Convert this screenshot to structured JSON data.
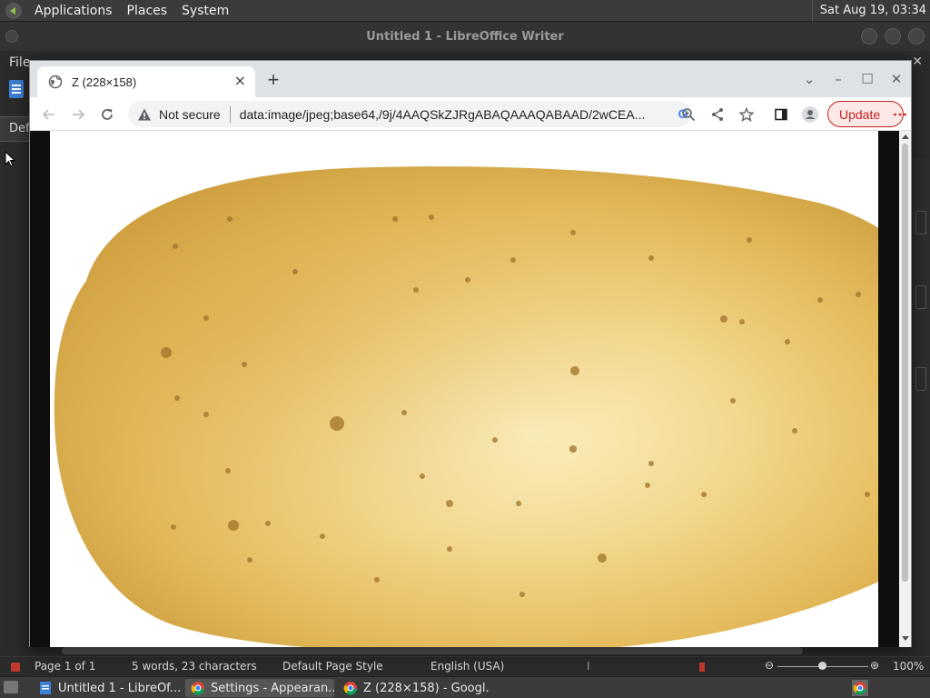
{
  "top_panel": {
    "menus": [
      "Applications",
      "Places",
      "System"
    ],
    "clock": "Sat Aug 19, 03:34"
  },
  "libreoffice": {
    "title": "Untitled 1 - LibreOffice Writer",
    "menu_first": "File",
    "style_box": "Def",
    "status": {
      "page": "Page 1 of 1",
      "words": "5 words, 23 characters",
      "page_style": "Default Page Style",
      "language": "English (USA)",
      "zoom": "100%"
    }
  },
  "chrome": {
    "tab_title": "Z (228×158)",
    "new_tab": "+",
    "tab_close": "×",
    "not_secure": "Not secure",
    "url": "data:image/jpeg;base64,/9j/4AAQSkZJRgABAQAAAQABAAD/2wCEA...",
    "update_label": "Update",
    "image_subject": "potato"
  },
  "taskbar": {
    "tasks": [
      "Untitled 1 - LibreOf...",
      "Settings - Appearan...",
      "Z (228×158) - Googl..."
    ]
  },
  "colors": {
    "update_red": "#c5221f",
    "panel_bg": "#3b3b3b"
  }
}
